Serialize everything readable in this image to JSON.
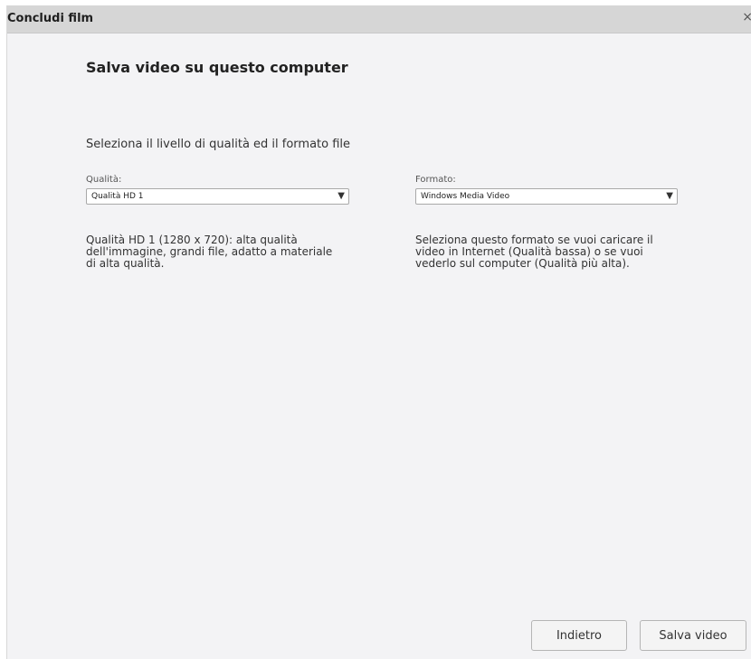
{
  "window": {
    "title": "Concludi film",
    "close_glyph": "×"
  },
  "main": {
    "heading": "Salva video su questo computer",
    "subheading": "Seleziona il livello di qualità ed il formato file"
  },
  "quality": {
    "label": "Qualità:",
    "selected": "Qualità HD 1",
    "description_lines": [
      "Qualità HD 1 (1280 x 720): alta qualità",
      "dell'immagine, grandi file, adatto a materiale",
      "di alta qualità."
    ]
  },
  "format": {
    "label": "Formato:",
    "selected": "Windows Media Video",
    "description_lines": [
      "Seleziona questo formato se vuoi caricare il",
      "video in Internet (Qualità bassa) o se vuoi",
      "vederlo sul computer (Qualità più alta)."
    ]
  },
  "footer": {
    "back_label": "Indietro",
    "save_label": "Salva video"
  },
  "icons": {
    "dropdown_arrow": "▼"
  }
}
